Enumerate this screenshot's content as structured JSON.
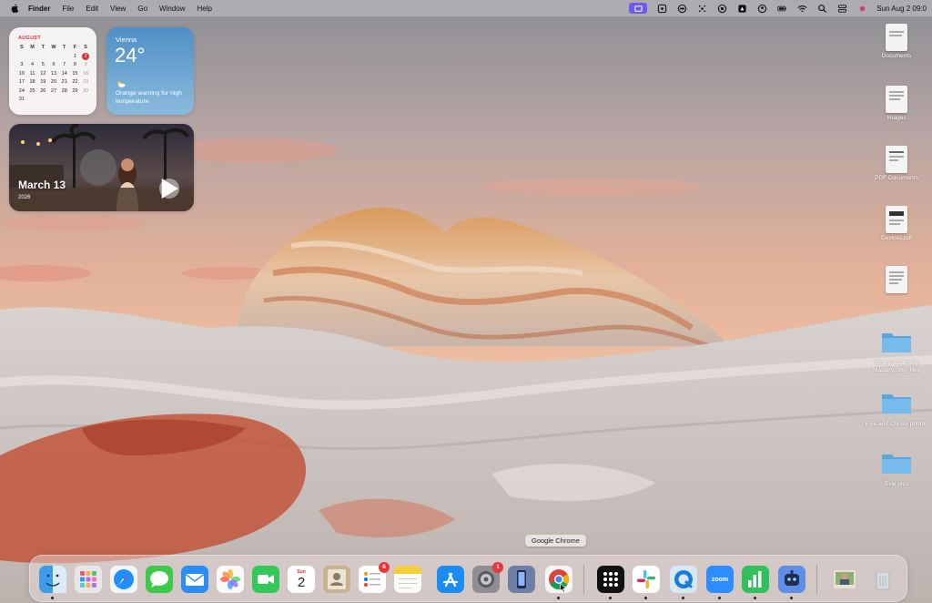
{
  "menubar": {
    "items": [
      "Finder",
      "File",
      "Edit",
      "View",
      "Go",
      "Window",
      "Help"
    ],
    "clock": "Sun Aug 2  09:0"
  },
  "widgets": {
    "calendar": {
      "month": "AUGUST",
      "weekday_headers": [
        "S",
        "M",
        "T",
        "W",
        "T",
        "F",
        "S"
      ],
      "weeks": [
        [
          "",
          "",
          "",
          "",
          "",
          "1",
          "2"
        ],
        [
          "3",
          "4",
          "5",
          "6",
          "7",
          "8",
          "9"
        ],
        [
          "10",
          "11",
          "12",
          "13",
          "14",
          "15",
          "16"
        ],
        [
          "17",
          "18",
          "19",
          "20",
          "21",
          "22",
          "23"
        ],
        [
          "24",
          "25",
          "26",
          "27",
          "28",
          "29",
          "30"
        ],
        [
          "31",
          "",
          "",
          "",
          "",
          "",
          ""
        ]
      ],
      "today": "2"
    },
    "weather": {
      "city": "Vienna",
      "temperature": "24°",
      "description": "Orange warning for high temperature"
    },
    "photo": {
      "date": "March 13",
      "year": "2026"
    }
  },
  "desktop_items": [
    {
      "label": "Documents",
      "kind": "document"
    },
    {
      "label": "Images",
      "kind": "document"
    },
    {
      "label": "PDF Documents",
      "kind": "document"
    },
    {
      "label": "Devices.pdf",
      "kind": "document"
    },
    {
      "label": "",
      "kind": "document"
    },
    {
      "label": "Group Coaching Mastery...ing_files",
      "kind": "folder"
    },
    {
      "label": "Evie and Christy photos",
      "kind": "folder"
    },
    {
      "label": "Evie pics",
      "kind": "folder"
    }
  ],
  "dock": {
    "tooltip": "Google Chrome",
    "apps": [
      {
        "name": "Finder",
        "icon": "finder-icon",
        "running": true
      },
      {
        "name": "Launchpad",
        "icon": "launchpad-icon",
        "running": false
      },
      {
        "name": "Safari",
        "icon": "safari-icon",
        "running": false
      },
      {
        "name": "Messages",
        "icon": "messages-icon",
        "running": false
      },
      {
        "name": "Mail",
        "icon": "mail-icon",
        "running": false
      },
      {
        "name": "Photos",
        "icon": "photos-icon",
        "running": false
      },
      {
        "name": "FaceTime",
        "icon": "facetime-icon",
        "running": false
      },
      {
        "name": "Calendar",
        "icon": "calendar-icon",
        "running": false,
        "month": "Sun",
        "day": "2"
      },
      {
        "name": "Contacts",
        "icon": "contacts-icon",
        "running": false
      },
      {
        "name": "Reminders",
        "icon": "reminders-icon",
        "running": false,
        "badge": "6"
      },
      {
        "name": "Notes",
        "icon": "notes-icon",
        "running": false
      },
      {
        "name": "App Store",
        "icon": "app-store-icon",
        "running": false
      },
      {
        "name": "System Settings",
        "icon": "settings-icon",
        "running": false,
        "badge": "1"
      },
      {
        "name": "iPhone Mirroring",
        "icon": "iphone-mirroring-icon",
        "running": false
      },
      {
        "name": "Google Chrome",
        "icon": "chrome-icon",
        "running": true
      },
      {
        "name": "Apps Grid",
        "icon": "grid-icon",
        "running": true
      },
      {
        "name": "Slack",
        "icon": "slack-icon",
        "running": true
      },
      {
        "name": "QuickTime",
        "icon": "quicktime-icon",
        "running": true
      },
      {
        "name": "Zoom",
        "icon": "zoom-icon",
        "running": true,
        "text": "zoom"
      },
      {
        "name": "Numbers",
        "icon": "numbers-icon",
        "running": true
      },
      {
        "name": "Assistant",
        "icon": "assistant-icon",
        "running": true
      },
      {
        "name": "Photo Stack",
        "icon": "photo-stack-icon",
        "running": false
      },
      {
        "name": "Trash",
        "icon": "trash-icon",
        "running": false
      }
    ]
  },
  "colors": {
    "accent_red": "#e0313b",
    "weather_blue": "#4f8ec6",
    "status_active": "#6b5bf0"
  }
}
